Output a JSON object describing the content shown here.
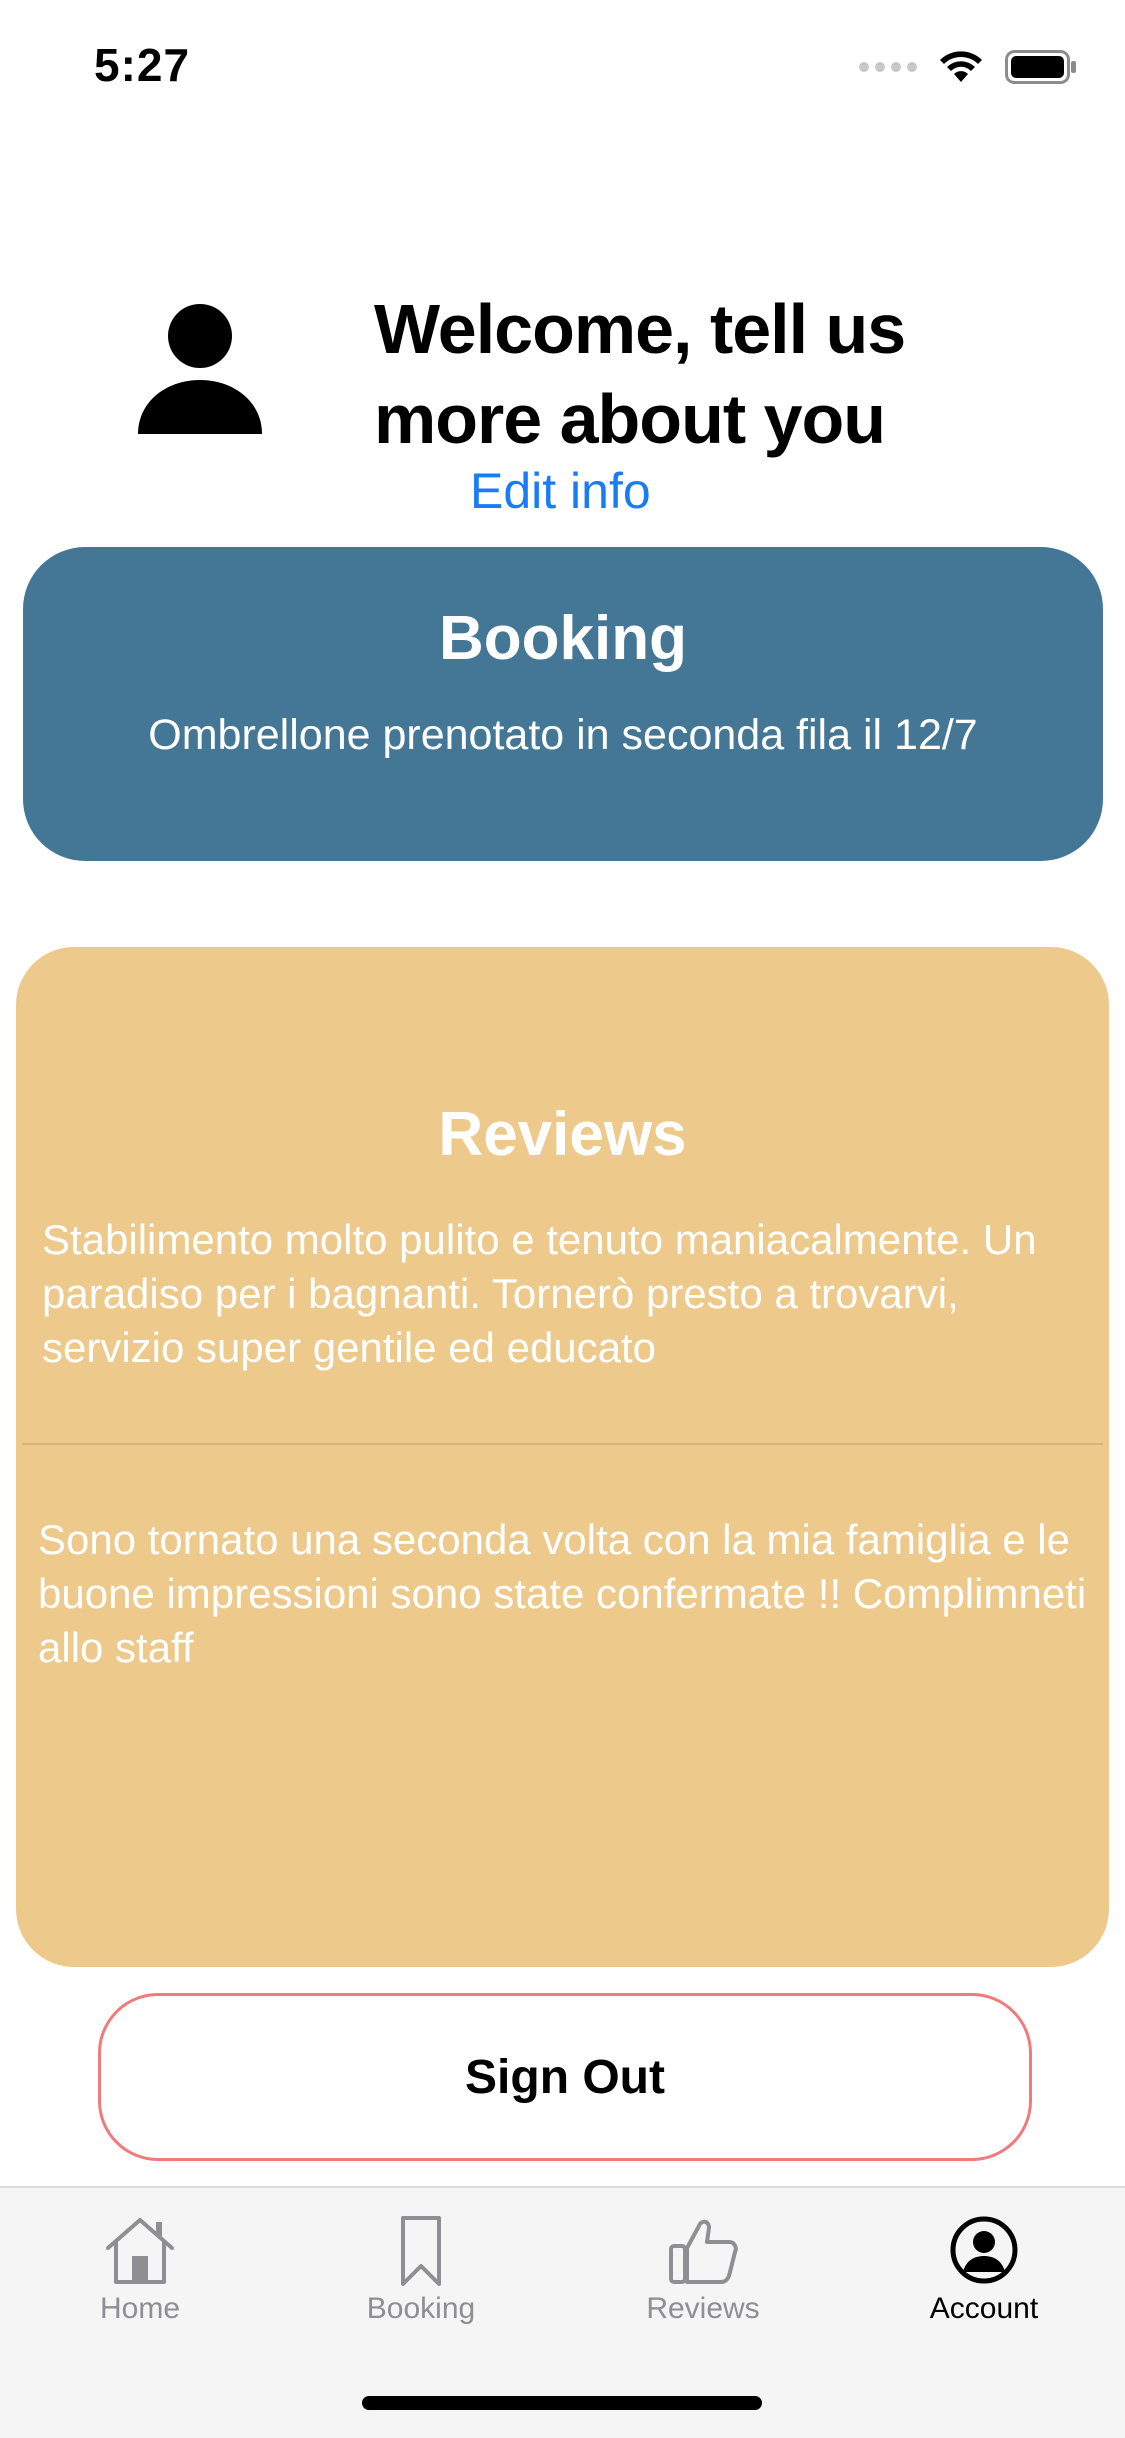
{
  "status_bar": {
    "time": "5:27"
  },
  "header": {
    "title": "Welcome, tell us more about you",
    "edit_link": "Edit info"
  },
  "booking": {
    "title": "Booking",
    "text": "Ombrellone prenotato in seconda fila il 12/7",
    "bg_color": "#437795"
  },
  "reviews": {
    "title": "Reviews",
    "bg_color": "#edca8c",
    "items": [
      {
        "text": "Stabilimento molto pulito e tenuto maniacalmente. Un paradiso per i bagnanti. Tornerò presto a trovarvi, servizio super gentile ed educato"
      },
      {
        "text": "Sono tornato una seconda volta con la mia famiglia e le buone impressioni sono state confermate !! Complimneti allo staff"
      }
    ]
  },
  "sign_out": {
    "label": "Sign Out",
    "border_color": "#ef7b7b"
  },
  "tab_bar": {
    "tabs": [
      {
        "label": "Home",
        "icon": "house-icon",
        "active": false
      },
      {
        "label": "Booking",
        "icon": "bookmark-icon",
        "active": false
      },
      {
        "label": "Reviews",
        "icon": "thumbs-up-icon",
        "active": false
      },
      {
        "label": "Account",
        "icon": "person-circle-icon",
        "active": true
      }
    ]
  }
}
